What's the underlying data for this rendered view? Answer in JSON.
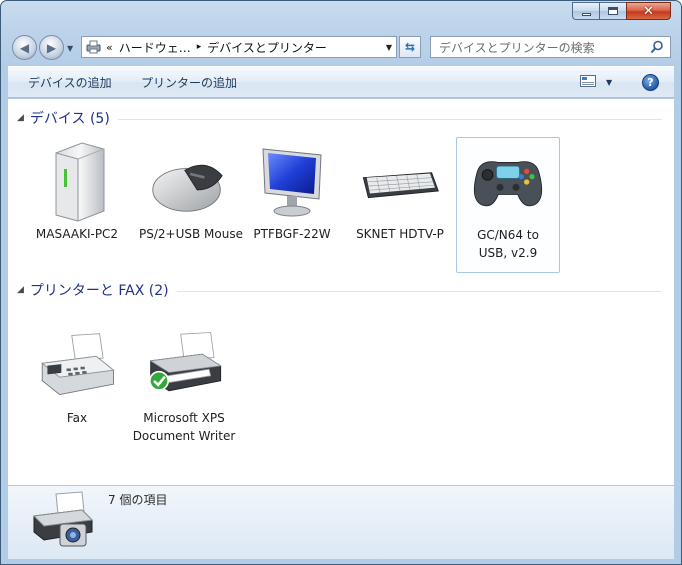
{
  "window": {
    "close_glyph": "✕"
  },
  "nav": {
    "breadcrumb_prefix": "«",
    "breadcrumb_1": "ハードウェ…",
    "breadcrumb_sep": "▸",
    "breadcrumb_2": "デバイスとプリンター",
    "search_placeholder": "デバイスとプリンターの検索"
  },
  "commands": {
    "add_device": "デバイスの追加",
    "add_printer": "プリンターの追加"
  },
  "groups": [
    {
      "title": "デバイス (5)",
      "items": [
        {
          "label": "MASAAKI-PC2",
          "icon": "computer-icon"
        },
        {
          "label": "PS/2+USB Mouse",
          "icon": "mouse-icon"
        },
        {
          "label": "PTFBGF-22W",
          "icon": "monitor-icon"
        },
        {
          "label": "SKNET HDTV-P",
          "icon": "keyboard-icon"
        },
        {
          "label": "GC/N64 to USB, v2.9",
          "icon": "gamepad-icon",
          "selected": true
        }
      ]
    },
    {
      "title": "プリンターと FAX (2)",
      "items": [
        {
          "label": "Fax",
          "icon": "fax-icon"
        },
        {
          "label": "Microsoft XPS Document Writer",
          "icon": "printer-icon",
          "default": true
        }
      ]
    }
  ],
  "details": {
    "count_text": "7 個の項目"
  },
  "colors": {
    "group_title": "#1e3287",
    "accent": "#2159a8"
  }
}
